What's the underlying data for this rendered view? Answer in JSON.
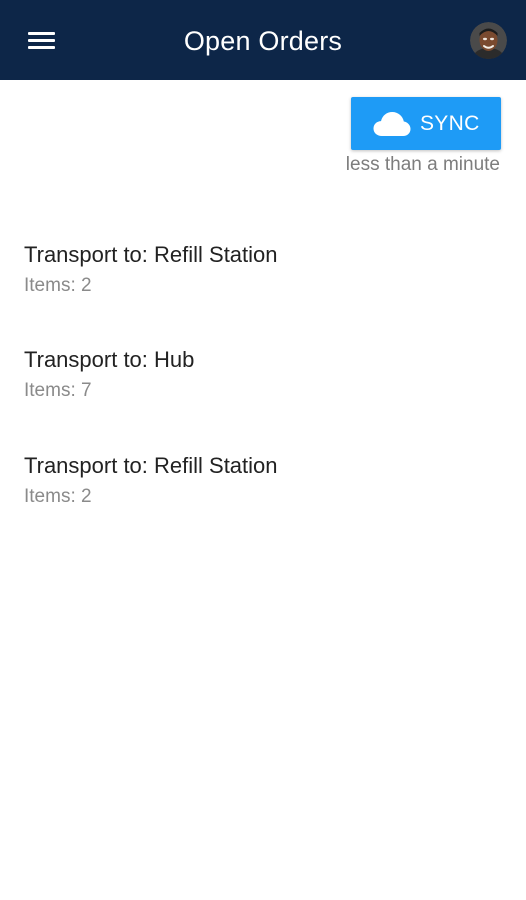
{
  "header": {
    "title": "Open Orders",
    "menu_icon": "hamburger-menu-icon",
    "avatar": "user-avatar"
  },
  "sync": {
    "label": "SYNC",
    "icon": "cloud-icon",
    "status": "less than a minute"
  },
  "orders": [
    {
      "destination": "Transport to: Refill Station",
      "items": "Items: 2"
    },
    {
      "destination": "Transport to: Hub",
      "items": "Items: 7"
    },
    {
      "destination": "Transport to: Refill Station",
      "items": "Items: 2"
    }
  ],
  "colors": {
    "appbar": "#0d2648",
    "sync_button": "#1e9bf6",
    "primary_text": "#222222",
    "secondary_text": "#8a8a8a"
  }
}
